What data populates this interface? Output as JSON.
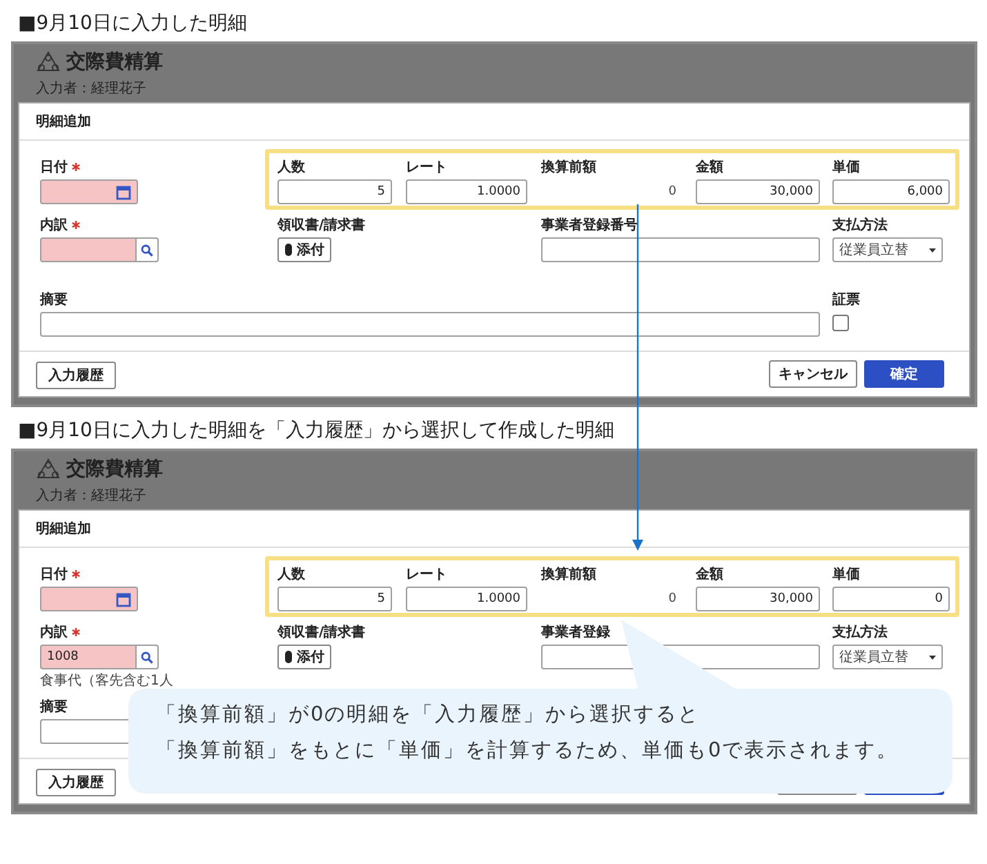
{
  "sections": [
    {
      "heading": "■9月10日に入力した明細",
      "panel": {
        "app_title": "交際費精算",
        "byline": "入力者：経理花子",
        "dialog_title": "明細追加",
        "fields": [
          {
            "label": "日付",
            "kind": "date",
            "required": true
          },
          {
            "label": "人数",
            "kind": "number",
            "value": "5"
          },
          {
            "label": "レート",
            "kind": "number",
            "value": "1.0000"
          },
          {
            "label": "換算前額",
            "kind": "readout",
            "value": "0"
          },
          {
            "label": "金額",
            "kind": "number",
            "value": "30,000"
          },
          {
            "label": "単価",
            "kind": "number",
            "value": "6,000"
          },
          {
            "label": "内訳",
            "kind": "lookup",
            "required": true
          },
          {
            "label": "領収書/請求書",
            "kind": "attach",
            "button": "添付"
          },
          {
            "label": "事業者登録番号",
            "kind": "text"
          },
          {
            "label": "支払方法",
            "kind": "select",
            "value": "従業員立替"
          },
          {
            "label": "摘要",
            "kind": "text"
          },
          {
            "label": "証票",
            "kind": "checkbox",
            "checked": false
          }
        ],
        "buttons": [
          {
            "label": "入力履歴",
            "kind": "secondary"
          },
          {
            "label": "キャンセル",
            "kind": "secondary"
          },
          {
            "label": "確定",
            "kind": "primary"
          }
        ]
      }
    },
    {
      "heading": "■9月10日に入力した明細を「入力履歴」から選択して作成した明細",
      "panel": {
        "app_title": "交際費精算",
        "byline": "入力者：経理花子",
        "dialog_title": "明細追加",
        "fields": [
          {
            "label": "日付",
            "kind": "date",
            "required": true
          },
          {
            "label": "人数",
            "kind": "number",
            "value": "5"
          },
          {
            "label": "レート",
            "kind": "number",
            "value": "1.0000"
          },
          {
            "label": "換算前額",
            "kind": "readout",
            "value": "0"
          },
          {
            "label": "金額",
            "kind": "number",
            "value": "30,000"
          },
          {
            "label": "単価",
            "kind": "number",
            "value": "0"
          },
          {
            "label": "内訳",
            "kind": "lookup",
            "required": true,
            "value": "1008",
            "note": "食事代（客先含む1人"
          },
          {
            "label": "領収書/請求書",
            "kind": "attach",
            "button": "添付"
          },
          {
            "label": "事業者登録",
            "kind": "text"
          },
          {
            "label": "支払方法",
            "kind": "select",
            "value": "従業員立替"
          },
          {
            "label": "摘要",
            "kind": "text"
          }
        ],
        "buttons": [
          {
            "label": "入力履歴",
            "kind": "secondary"
          },
          {
            "kind": "secondary"
          },
          {
            "kind": "primary"
          }
        ]
      },
      "callout": {
        "lines": [
          "「換算前額」が0の明細を「入力履歴」から選択すると",
          "「換算前額」をもとに「単価」を計算するため、単価も0で表示されます。"
        ]
      }
    }
  ]
}
